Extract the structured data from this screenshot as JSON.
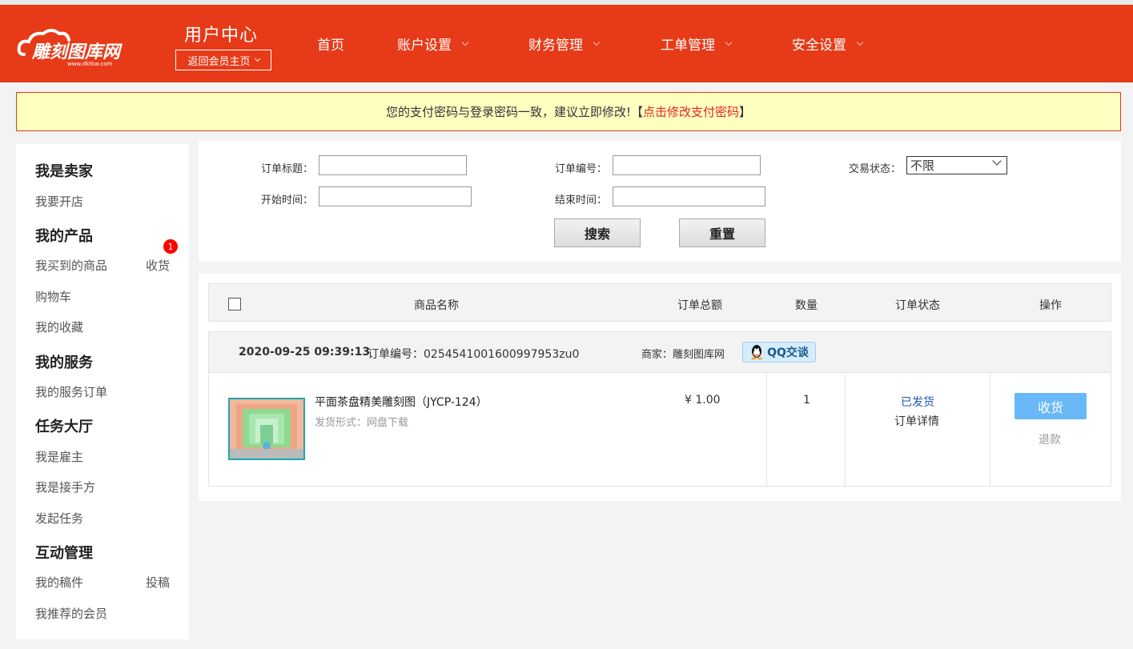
{
  "header": {
    "logo_text": "雕刻图库网",
    "logo_sub": "www.dktkw.com",
    "title": "用户中心",
    "back_home": "返回会员主页",
    "nav": [
      "首页",
      "账户设置",
      "财务管理",
      "工单管理",
      "安全设置"
    ]
  },
  "notice": {
    "text": "您的支付密码与登录密码一致，建议立即修改!【",
    "link": "点击修改支付密码",
    "end": "】"
  },
  "sidebar": {
    "seller_heading": "我是卖家",
    "open_shop": "我要开店",
    "products_heading": "我的产品",
    "bought_items": "我买到的商品",
    "receive_link": "收货",
    "receive_badge": "1",
    "cart": "购物车",
    "favorites": "我的收藏",
    "services_heading": "我的服务",
    "service_orders": "我的服务订单",
    "tasks_heading": "任务大厅",
    "employer": "我是雇主",
    "contractor": "我是接手方",
    "post_task": "发起任务",
    "interaction_heading": "互动管理",
    "manuscripts": "我的稿件",
    "submit": "投稿",
    "referred": "我推荐的会员"
  },
  "search": {
    "order_title_label": "订单标题：",
    "order_no_label": "订单编号：",
    "trade_status_label": "交易状态：",
    "trade_status_value": "不限",
    "start_time_label": "开始时间：",
    "end_time_label": "结束时间：",
    "search_btn": "搜索",
    "reset_btn": "重置"
  },
  "table": {
    "headers": [
      "商品名称",
      "订单总额",
      "数量",
      "订单状态",
      "操作"
    ]
  },
  "order": {
    "time": "2020-09-25 09:39:13",
    "order_no": "订单编号：0254541001600997953zu0",
    "shop": "商家：雕刻图库网",
    "qq_label": "QQ交谈",
    "product_name": "平面茶盘精美雕刻图（JYCP-124）",
    "delivery": "发货形式：网盘下载",
    "price": "¥ 1.00",
    "qty": "1",
    "status": "已发货",
    "detail": "订单详情",
    "receive_btn": "收货",
    "refund": "退款"
  }
}
